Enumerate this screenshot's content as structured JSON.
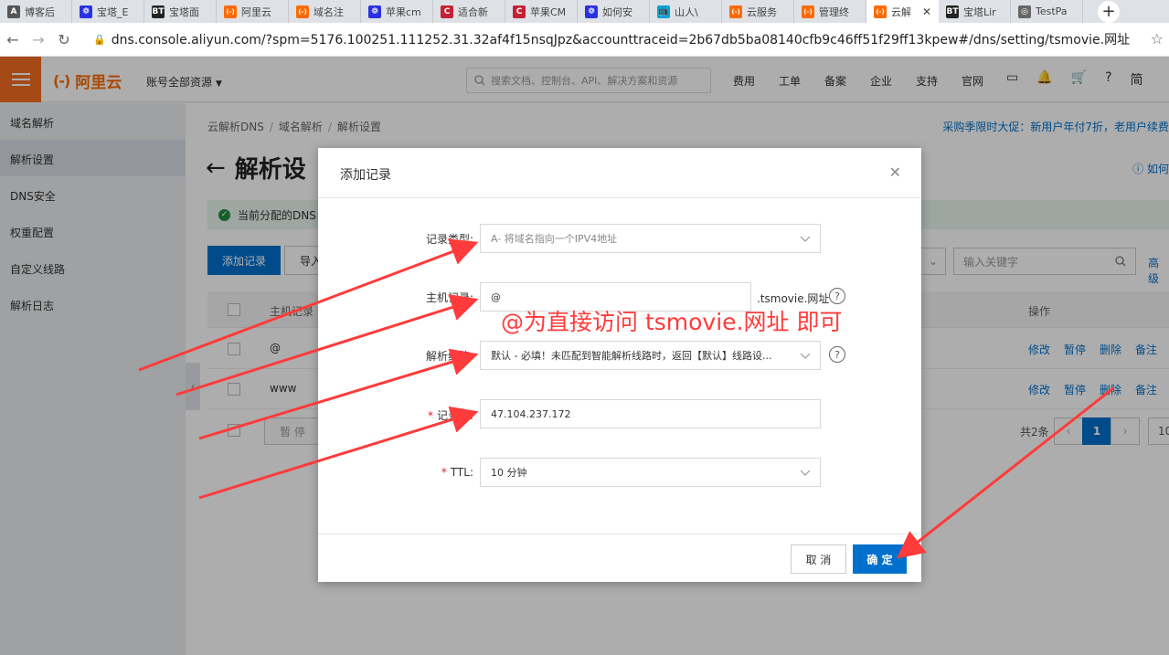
{
  "browser": {
    "tabs": [
      {
        "label": "博客后",
        "icon": "aliyun-a-icon",
        "color": "#555555"
      },
      {
        "label": "宝塔_E",
        "icon": "baidu-paw-icon",
        "color": "#2932e1"
      },
      {
        "label": "宝塔面",
        "icon": "bt-icon",
        "color": "#222222"
      },
      {
        "label": "阿里云",
        "icon": "aliyun-icon",
        "color": "#ff6a00"
      },
      {
        "label": "域名注",
        "icon": "aliyun-icon",
        "color": "#ff6a00"
      },
      {
        "label": "苹果cm",
        "icon": "baidu-paw-icon",
        "color": "#2932e1"
      },
      {
        "label": "适合新",
        "icon": "csdn-icon",
        "color": "#c32136"
      },
      {
        "label": "苹果CM",
        "icon": "csdn-icon",
        "color": "#c32136"
      },
      {
        "label": "如何安",
        "icon": "baidu-paw-icon",
        "color": "#2932e1"
      },
      {
        "label": "山人\\",
        "icon": "bilibili-icon",
        "color": "#00a1d6"
      },
      {
        "label": "云服务",
        "icon": "aliyun-icon",
        "color": "#ff6a00"
      },
      {
        "label": "管理终",
        "icon": "aliyun-icon",
        "color": "#ff6a00"
      },
      {
        "label": "云解",
        "icon": "aliyun-icon",
        "color": "#ff6a00",
        "active": true
      },
      {
        "label": "宝塔Lir",
        "icon": "bt-icon",
        "color": "#222222"
      },
      {
        "label": "TestPa",
        "icon": "globe-icon",
        "color": "#666666"
      }
    ],
    "url": "dns.console.aliyun.com/?spm=5176.100251.111252.31.32af4f15nsqJpz&accounttraceid=2b67db5ba08140cfb9c46ff51f29ff13kpew#/dns/setting/tsmovie.网址"
  },
  "topbar": {
    "brand": "阿里云",
    "account": "账号全部资源",
    "search_placeholder": "搜索文档、控制台、API、解决方案和资源",
    "nav": [
      "费用",
      "工单",
      "备案",
      "企业",
      "支持",
      "官网"
    ]
  },
  "sidebar": {
    "items": [
      "域名解析",
      "解析设置",
      "DNS安全",
      "权重配置",
      "自定义线路",
      "解析日志"
    ],
    "active_index": 1
  },
  "main": {
    "breadcrumb": [
      "云解析DNS",
      "域名解析",
      "解析设置"
    ],
    "promo": "采购季限时大促：新用户年付7折，老用户续费",
    "title": "解析设",
    "help": "如何",
    "notice": "当前分配的DNS",
    "add_button": "添加记录",
    "import_button": "导入",
    "keyword_placeholder": "输入关键字",
    "advanced": "高级",
    "table": {
      "host_header": "主机记录",
      "op_header": "操作",
      "rows": [
        {
          "host": "@",
          "ops": [
            "修改",
            "暂停",
            "删除",
            "备注"
          ]
        },
        {
          "host": "www",
          "ops": [
            "修改",
            "暂停",
            "删除",
            "备注"
          ]
        }
      ]
    },
    "pause_button": "暂 停",
    "total": "共2条",
    "page_current": "1",
    "page_size": "10"
  },
  "modal": {
    "title": "添加记录",
    "fields": {
      "record_type": {
        "label": "记录类型:",
        "value": "A- 将域名指向一个IPV4地址"
      },
      "host": {
        "label": "主机记录:",
        "value": "@",
        "suffix": ".tsmovie.网址"
      },
      "line": {
        "label": "解析线路:",
        "value": "默认 - 必填！未匹配到智能解析线路时，返回【默认】线路设..."
      },
      "record_value": {
        "label": "记录值:",
        "value": "47.104.237.172"
      },
      "ttl": {
        "label": "TTL:",
        "value": "10 分钟"
      }
    },
    "cancel": "取 消",
    "confirm": "确 定"
  },
  "annotation": "@为直接访问 tsmovie.网址 即可",
  "colors": {
    "brand": "#ff6a00",
    "primary": "#0070cc",
    "annotation": "#ff3b3b"
  }
}
